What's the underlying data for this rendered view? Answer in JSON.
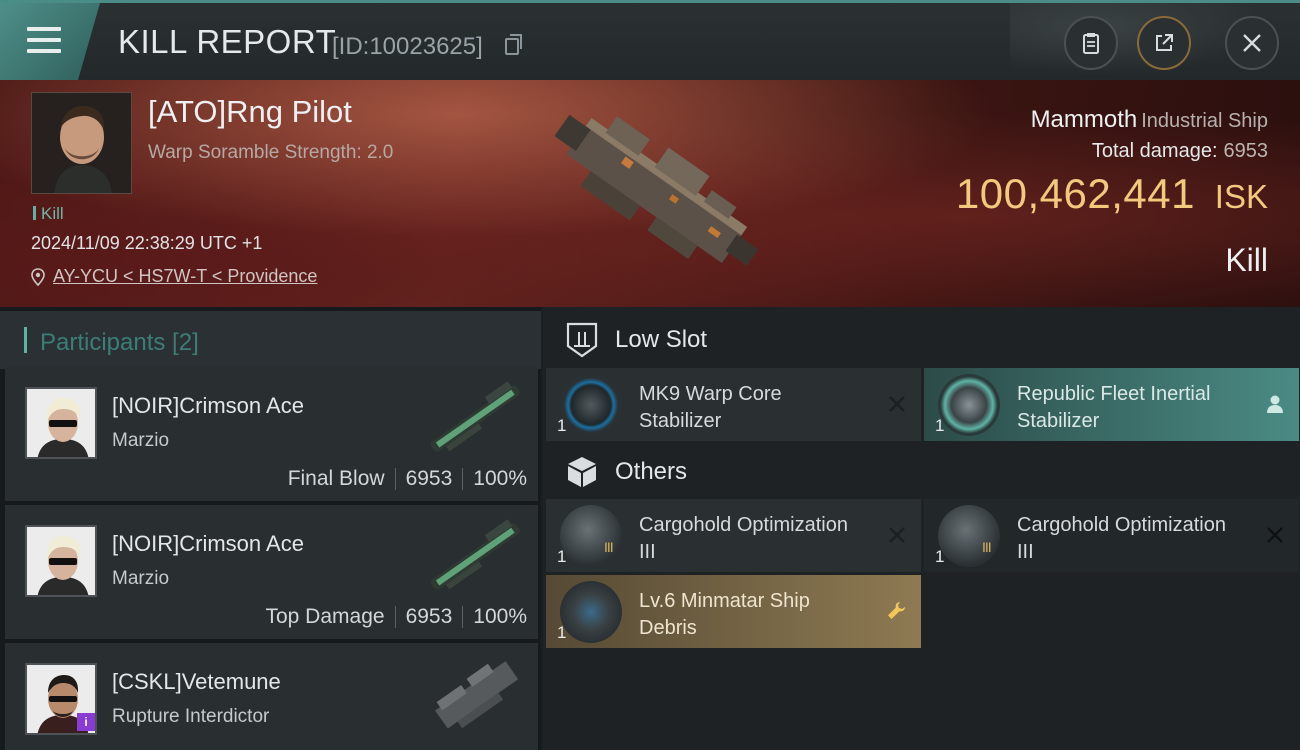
{
  "header": {
    "title": "KILL REPORT",
    "report_id": "[ID:10023625]",
    "buttons": [
      "clipboard-icon",
      "share-icon",
      "close-icon"
    ]
  },
  "victim": {
    "name": "[ATO]Rng Pilot",
    "stat": "Warp Soramble Strength: 2.0",
    "tag": "Kill",
    "timestamp": "2024/11/09 22:38:29 UTC +1",
    "location": "AY-YCU < HS7W-T < Providence",
    "ship_name": "Mammoth",
    "ship_class": "Industrial Ship",
    "total_damage_label": "Total damage:",
    "total_damage": "6953",
    "isk_value": "100,462,441",
    "isk_unit": "ISK",
    "result": "Kill"
  },
  "participants": {
    "title": "Participants [2]",
    "items": [
      {
        "name": "[NOIR]Crimson Ace",
        "sub": "Marzio",
        "label": "Final Blow",
        "damage": "6953",
        "percent": "100%"
      },
      {
        "name": "[NOIR]Crimson Ace",
        "sub": "Marzio",
        "label": "Top Damage",
        "damage": "6953",
        "percent": "100%"
      },
      {
        "name": "[CSKL]Vetemune",
        "sub": "Rupture Interdictor"
      }
    ]
  },
  "modules": {
    "low_slot_label": "Low Slot",
    "others_label": "Others",
    "low_slot": [
      {
        "qty": "1",
        "name": "MK9 Warp Core Stabilizer",
        "state": "destroyed"
      },
      {
        "qty": "1",
        "name": "Republic Fleet Inertial Stabilizer",
        "state": "dropped"
      }
    ],
    "others": [
      {
        "qty": "1",
        "name": "Cargohold Optimization III",
        "state": "destroyed"
      },
      {
        "qty": "1",
        "name": "Cargohold Optimization III",
        "state": "destroyed"
      },
      {
        "qty": "1",
        "name": "Lv.6 Minmatar Ship Debris",
        "state": "dropped"
      }
    ]
  },
  "colors": {
    "accent_teal": "#4a8b84",
    "isk_gold": "#f2c97d",
    "debris_gold": "#8e7a52"
  }
}
